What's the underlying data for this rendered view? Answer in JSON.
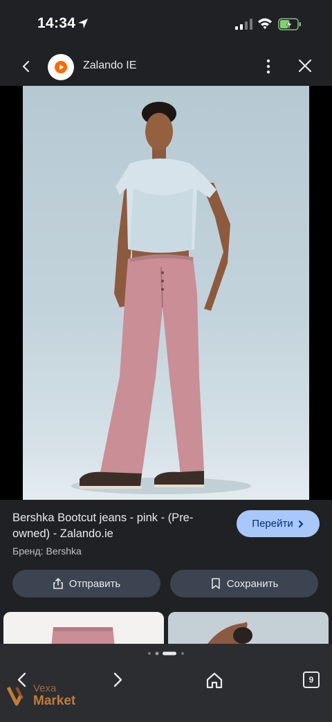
{
  "status_bar": {
    "time": "14:34",
    "icons": [
      "location-arrow-icon",
      "signal-icon",
      "wifi-icon",
      "battery-charging-icon"
    ]
  },
  "app_bar": {
    "site_name": "Zalando IE",
    "icons": [
      "back-arrow-icon",
      "zalando-logo",
      "more-vert-icon",
      "close-icon"
    ]
  },
  "product": {
    "title": "Bershka Bootcut jeans - pink - (Pre-owned) - Zalando.ie",
    "go_button": "Перейти",
    "brand": "Бренд: Bershka"
  },
  "actions": {
    "share_label": "Отправить",
    "save_label": "Сохранить"
  },
  "bottom_nav": {
    "tab_count": "9",
    "icons": [
      "nav-back-icon",
      "nav-forward-icon",
      "home-icon",
      "tabs-icon"
    ]
  },
  "watermark": {
    "line1": "Vexa",
    "line2": "Market"
  },
  "colors": {
    "background": "#202124",
    "accent_button": "#a8c7fa",
    "action_button": "#3c4451",
    "pants": "#c98e96",
    "shirt": "#d5e2ea"
  }
}
